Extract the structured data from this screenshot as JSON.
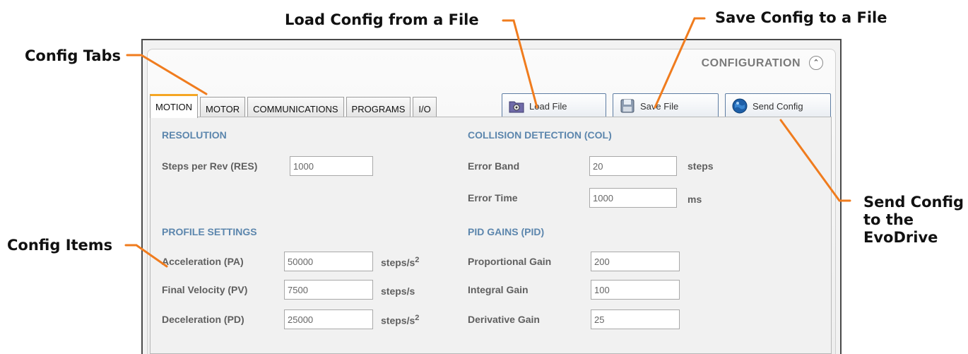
{
  "callouts": {
    "config_tabs": "Config Tabs",
    "load_config": "Load Config from a File",
    "save_config": "Save Config to a File",
    "send_config_1": "Send Config",
    "send_config_2": "to the",
    "send_config_3": "EvoDrive",
    "config_items": "Config Items"
  },
  "colors": {
    "callout_line": "#f07c1e",
    "section_heading": "#5c86ad",
    "active_tab_accent": "#f5a623"
  },
  "window": {
    "title": "CONFIGURATION",
    "collapse_icon": "double-chevron-up-icon"
  },
  "tabs": [
    {
      "label": "MOTION",
      "active": true
    },
    {
      "label": "MOTOR"
    },
    {
      "label": "COMMUNICATIONS"
    },
    {
      "label": "PROGRAMS"
    },
    {
      "label": "I/O"
    }
  ],
  "buttons": {
    "load": {
      "label": "Load File",
      "icon": "folder-gear-icon"
    },
    "save": {
      "label": "Save File",
      "icon": "disk-icon"
    },
    "send": {
      "label": "Send Config",
      "icon": "globe-icon"
    }
  },
  "resolution": {
    "heading": "RESOLUTION",
    "steps_per_rev": {
      "label": "Steps per Rev (RES)",
      "value": "1000"
    }
  },
  "collision": {
    "heading": "COLLISION DETECTION (COL)",
    "error_band": {
      "label": "Error Band",
      "value": "20",
      "unit": "steps"
    },
    "error_time": {
      "label": "Error Time",
      "value": "1000",
      "unit": "ms"
    }
  },
  "profile": {
    "heading": "PROFILE SETTINGS",
    "acceleration": {
      "label": "Acceleration (PA)",
      "value": "50000",
      "unit": "steps/s",
      "sup": "2"
    },
    "final_velocity": {
      "label": "Final Velocity (PV)",
      "value": "7500",
      "unit": "steps/s"
    },
    "deceleration": {
      "label": "Deceleration (PD)",
      "value": "25000",
      "unit": "steps/s",
      "sup": "2"
    }
  },
  "pid": {
    "heading": "PID GAINS (PID)",
    "proportional": {
      "label": "Proportional Gain",
      "value": "200"
    },
    "integral": {
      "label": "Integral Gain",
      "value": "100"
    },
    "derivative": {
      "label": "Derivative Gain",
      "value": "25"
    }
  }
}
